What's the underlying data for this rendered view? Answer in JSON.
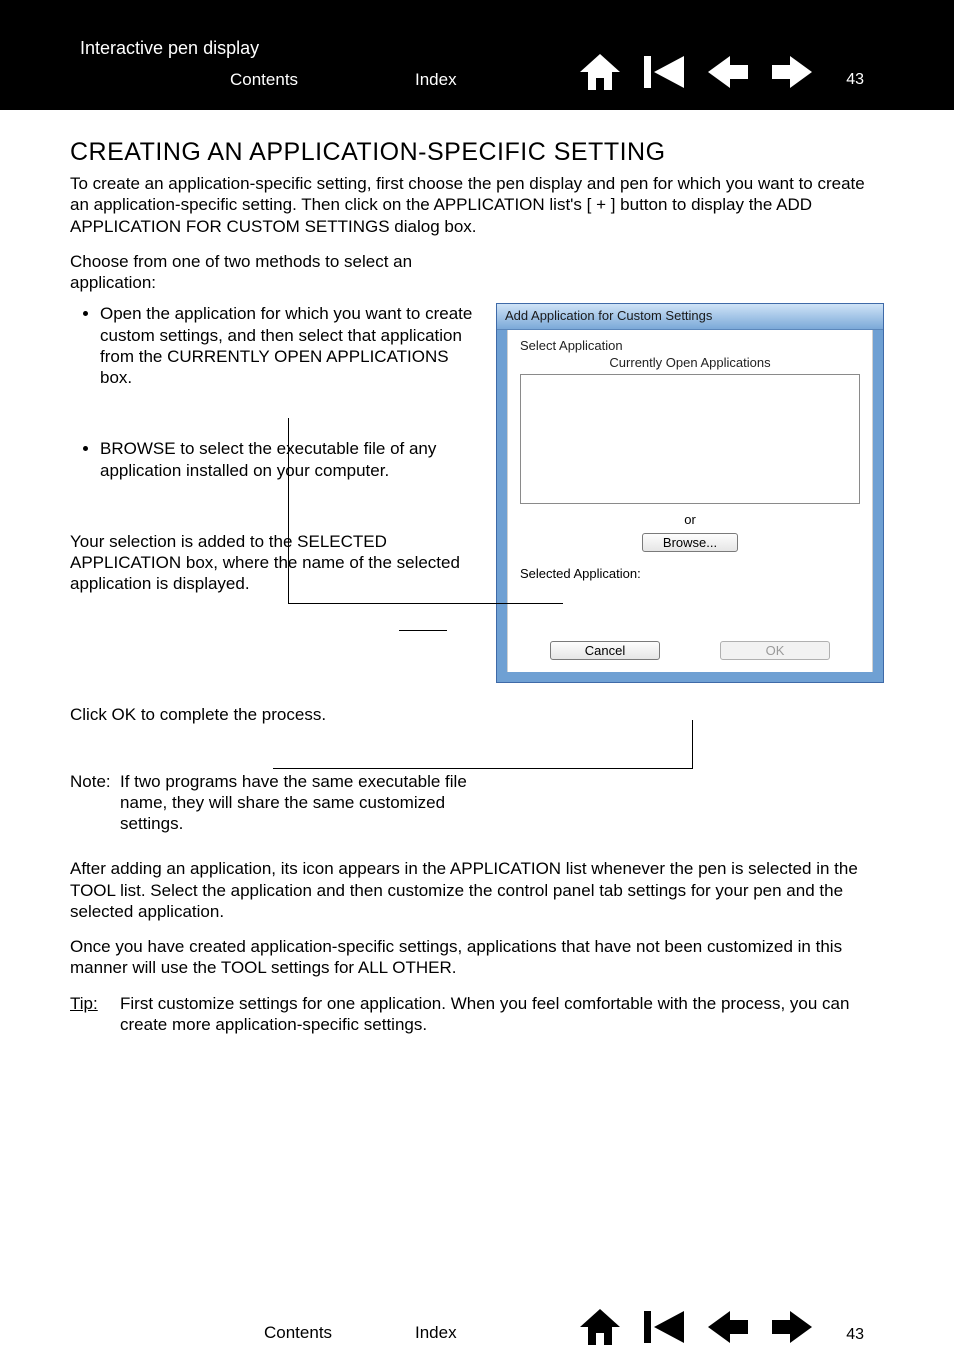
{
  "header": {
    "doc_title": "Interactive pen display",
    "contents": "Contents",
    "index": "Index",
    "page_number": "43"
  },
  "footer": {
    "contents": "Contents",
    "index": "Index",
    "page_number": "43"
  },
  "heading": "CREATING AN APPLICATION-SPECIFIC SETTING",
  "intro": "To create an application-specific setting, first choose the pen display and pen for which you want to create an application-specific setting.  Then click on the APPLICATION list's [ + ] button to display the ADD APPLICATION FOR CUSTOM SETTINGS dialog box.",
  "choose_methods": "Choose from one of two methods to select an application:",
  "bullet1": "Open the application for which you want to create custom settings, and then select that application from the CURRENTLY OPEN APPLICATIONS box.",
  "bullet2": "BROWSE to select the executable file of any application installed on your computer.",
  "selection_para": "Your selection is added to the SELECTED APPLICATION box, where the name of the selected application is displayed.",
  "ok_para": "Click OK to complete the process.",
  "note_label": "Note:",
  "note_text": "If two programs have the same executable file name, they will share the same customized settings.",
  "after_para": "After adding an application, its icon appears in the APPLICATION list whenever the pen is selected in the TOOL list.  Select the application and then customize the control panel tab settings for your pen and the selected application.",
  "once_para": "Once you have created application-specific settings, applications that have not been customized in this manner will use the TOOL settings for ALL OTHER.",
  "tip_label": "Tip",
  "tip_text": "First customize settings for one application.  When you feel comfortable with the process, you can create more application-specific settings.",
  "dialog": {
    "title": "Add Application for Custom Settings",
    "select_app": "Select Application",
    "currently_open": "Currently Open Applications",
    "or": "or",
    "browse": "Browse...",
    "selected_app": "Selected Application:",
    "cancel": "Cancel",
    "ok": "OK"
  }
}
